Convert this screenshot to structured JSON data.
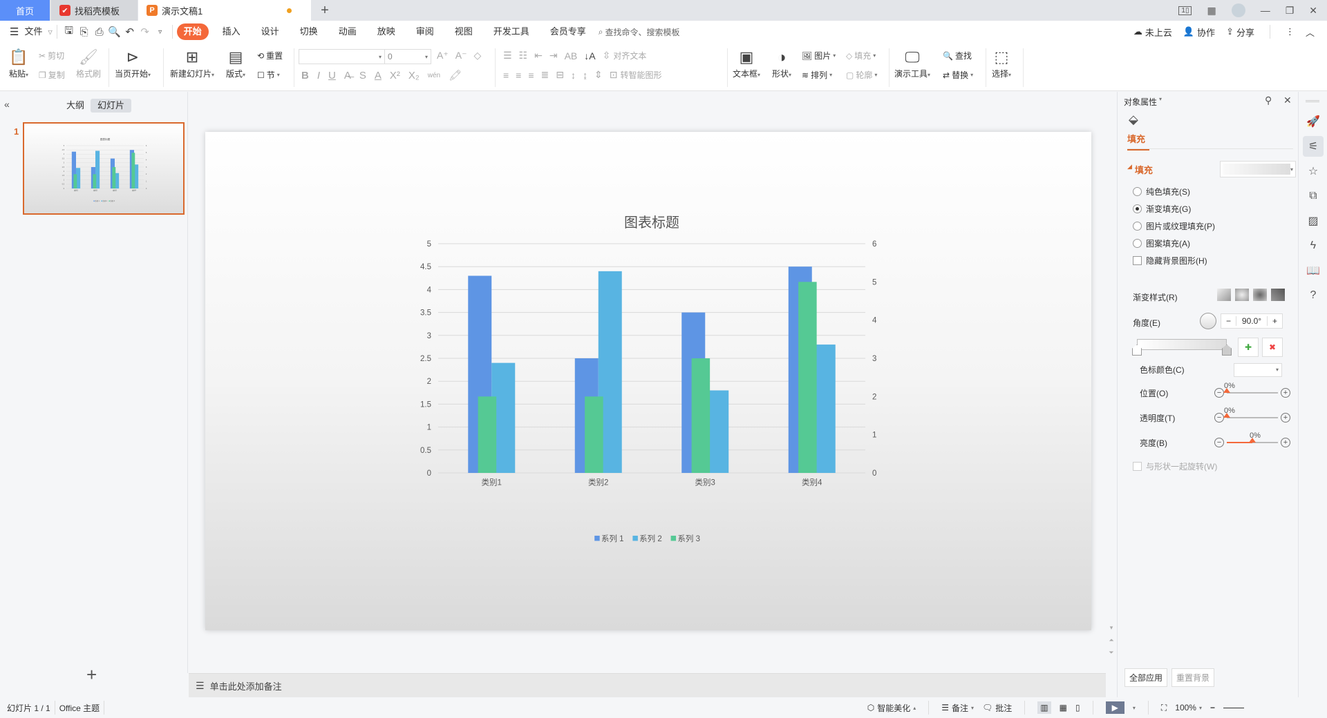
{
  "tabs": [
    {
      "label": "首页",
      "icon": "home"
    },
    {
      "label": "找稻壳模板",
      "icon": "docer-logo"
    },
    {
      "label": "演示文稿1",
      "icon": "presentation-logo",
      "unsaved": true
    }
  ],
  "menu": {
    "file": "文件",
    "items": [
      "开始",
      "插入",
      "设计",
      "切换",
      "动画",
      "放映",
      "审阅",
      "视图",
      "开发工具",
      "会员专享"
    ],
    "active": "开始",
    "search_placeholder": "查找命令、搜索模板",
    "right": {
      "cloud": "未上云",
      "collab": "协作",
      "share": "分享"
    }
  },
  "ribbon": {
    "paste": "粘贴",
    "cut": "剪切",
    "copy": "复制",
    "format_painter": "格式刷",
    "play_from_current": "当页开始",
    "new_slide": "新建幻灯片",
    "layout": "版式",
    "reset": "重置",
    "section": "节",
    "font_name": "",
    "font_size": "0",
    "phonetic": "wén",
    "align_text": "对齐文本",
    "smartart": "转智能图形",
    "textbox": "文本框",
    "shape": "形状",
    "picture": "图片",
    "arrange": "排列",
    "fill": "填充",
    "outline": "轮廓",
    "present_tools": "演示工具",
    "find": "查找",
    "replace": "替换",
    "select": "选择"
  },
  "left_panel": {
    "outline_tab": "大纲",
    "slides_tab": "幻灯片",
    "slide_number": "1",
    "add_label": "+"
  },
  "notes_placeholder": "单击此处添加备注",
  "chart_data": {
    "type": "bar",
    "title": "图表标题",
    "categories": [
      "类别1",
      "类别2",
      "类别3",
      "类别4"
    ],
    "series": [
      {
        "name": "系列 1",
        "axis": "primary",
        "color": "#5e95e4",
        "values": [
          4.3,
          2.5,
          3.5,
          4.5
        ]
      },
      {
        "name": "系列 3",
        "axis": "secondary",
        "color": "#55c994",
        "values": [
          2,
          2,
          3,
          5
        ]
      },
      {
        "name": "系列 2",
        "axis": "primary",
        "color": "#58b4e2",
        "values": [
          2.4,
          4.4,
          1.8,
          2.8
        ]
      }
    ],
    "legend_order": [
      "系列 1",
      "系列 2",
      "系列 3"
    ],
    "y_primary": {
      "min": 0,
      "max": 5,
      "step": 0.5,
      "ticks": [
        "0",
        "0.5",
        "1",
        "1.5",
        "2",
        "2.5",
        "3",
        "3.5",
        "4",
        "4.5",
        "5"
      ]
    },
    "y_secondary": {
      "min": 0,
      "max": 6,
      "step": 1,
      "ticks": [
        "0",
        "1",
        "2",
        "3",
        "4",
        "5",
        "6"
      ]
    },
    "grid": true,
    "legend": "bottom",
    "xlabel": "",
    "ylabel": ""
  },
  "right_panel": {
    "title": "对象属性",
    "tab": "填充",
    "section": "填充",
    "options": [
      {
        "label": "纯色填充(S)",
        "checked": false
      },
      {
        "label": "渐变填充(G)",
        "checked": true
      },
      {
        "label": "图片或纹理填充(P)",
        "checked": false
      },
      {
        "label": "图案填充(A)",
        "checked": false
      }
    ],
    "hide_bg": "隐藏背景图形(H)",
    "gradient_style": "渐变样式(R)",
    "angle_label": "角度(E)",
    "angle_value": "90.0°",
    "stop_color": "色标颜色(C)",
    "position": {
      "label": "位置(O)",
      "value": "0%",
      "fraction": 0
    },
    "transparency": {
      "label": "透明度(T)",
      "value": "0%",
      "fraction": 0
    },
    "brightness": {
      "label": "亮度(B)",
      "value": "0%",
      "fraction": 0.5
    },
    "rotate_with_shape": "与形状一起旋转(W)",
    "apply_all": "全部应用",
    "reset_bg": "重置背景"
  },
  "status": {
    "slide_info": "幻灯片 1 / 1",
    "theme": "Office 主题",
    "beautify": "智能美化",
    "notes": "备注",
    "comments": "批注",
    "zoom": "100%"
  }
}
